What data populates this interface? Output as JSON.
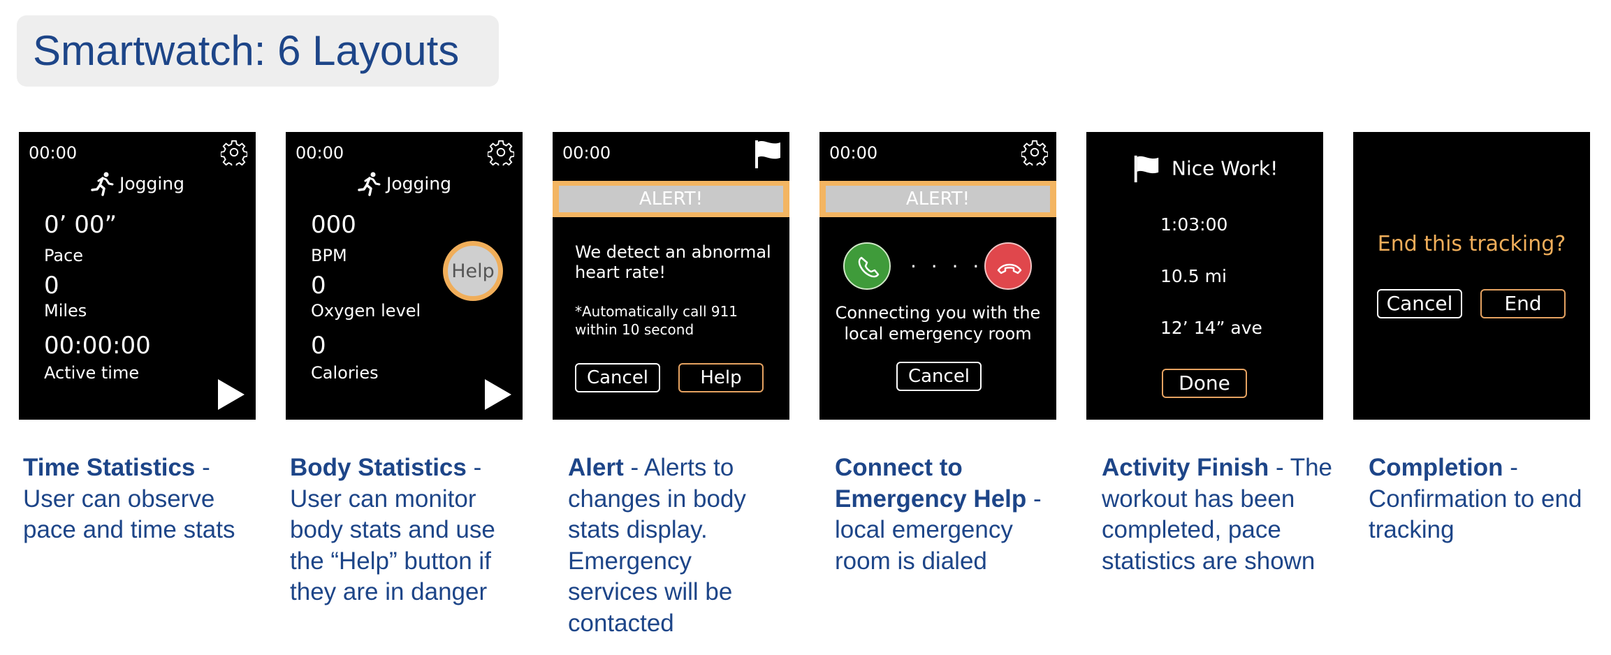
{
  "page": {
    "title": "Smartwatch: 6 Layouts"
  },
  "colors": {
    "title_blue": "#1d4588",
    "accent_orange": "#f0ae5a",
    "alert_gray": "#c9c9c9",
    "call_green": "#3f9b3a",
    "hangup_red": "#e0474c"
  },
  "screens": {
    "time_stats": {
      "clock": "00:00",
      "activity": "Jogging",
      "pace_value": "0’ 00”",
      "pace_label": "Pace",
      "miles_value": "0",
      "miles_label": "Miles",
      "time_value": "00:00:00",
      "time_label": "Active time",
      "icons": [
        "gear-icon",
        "runner-icon",
        "play-icon"
      ]
    },
    "body_stats": {
      "clock": "00:00",
      "activity": "Jogging",
      "bpm_value": "000",
      "bpm_label": "BPM",
      "oxygen_value": "0",
      "oxygen_label": "Oxygen level",
      "calories_value": "0",
      "calories_label": "Calories",
      "help_label": "Help",
      "icons": [
        "gear-icon",
        "runner-icon",
        "play-icon"
      ]
    },
    "alert": {
      "clock": "00:00",
      "banner": "ALERT!",
      "message": "We detect an abnormal heart rate!",
      "note": "*Automatically call 911 within 10 second",
      "cancel_label": "Cancel",
      "help_label": "Help",
      "icons": [
        "flag-icon"
      ]
    },
    "connect": {
      "clock": "00:00",
      "banner": "ALERT!",
      "dots": "· · · · ·",
      "message": "Connecting you with the local emergency room",
      "cancel_label": "Cancel",
      "icons": [
        "gear-icon",
        "phone-call-icon",
        "phone-hangup-icon"
      ]
    },
    "finish": {
      "title": "Nice Work!",
      "time": "1:03:00",
      "distance": "10.5 mi",
      "pace": "12’ 14” ave",
      "done_label": "Done",
      "icons": [
        "flag-icon"
      ]
    },
    "completion": {
      "question": "End this tracking?",
      "cancel_label": "Cancel",
      "end_label": "End"
    }
  },
  "captions": [
    {
      "title": "Time Statistics",
      "text": " - User can observe pace and time stats"
    },
    {
      "title": "Body Statistics",
      "text": " - User can monitor body stats and use the “Help” button if they are in danger"
    },
    {
      "title": "Alert",
      "text": " - Alerts to changes in body stats display. Emergency services will be contacted"
    },
    {
      "title": "Connect to Emergency Help",
      "text": " - local emergency room is dialed"
    },
    {
      "title": "Activity Finish",
      "text": " - The workout has been completed, pace statistics are shown"
    },
    {
      "title": "Completion",
      "text": " - Confirmation to end tracking"
    }
  ]
}
